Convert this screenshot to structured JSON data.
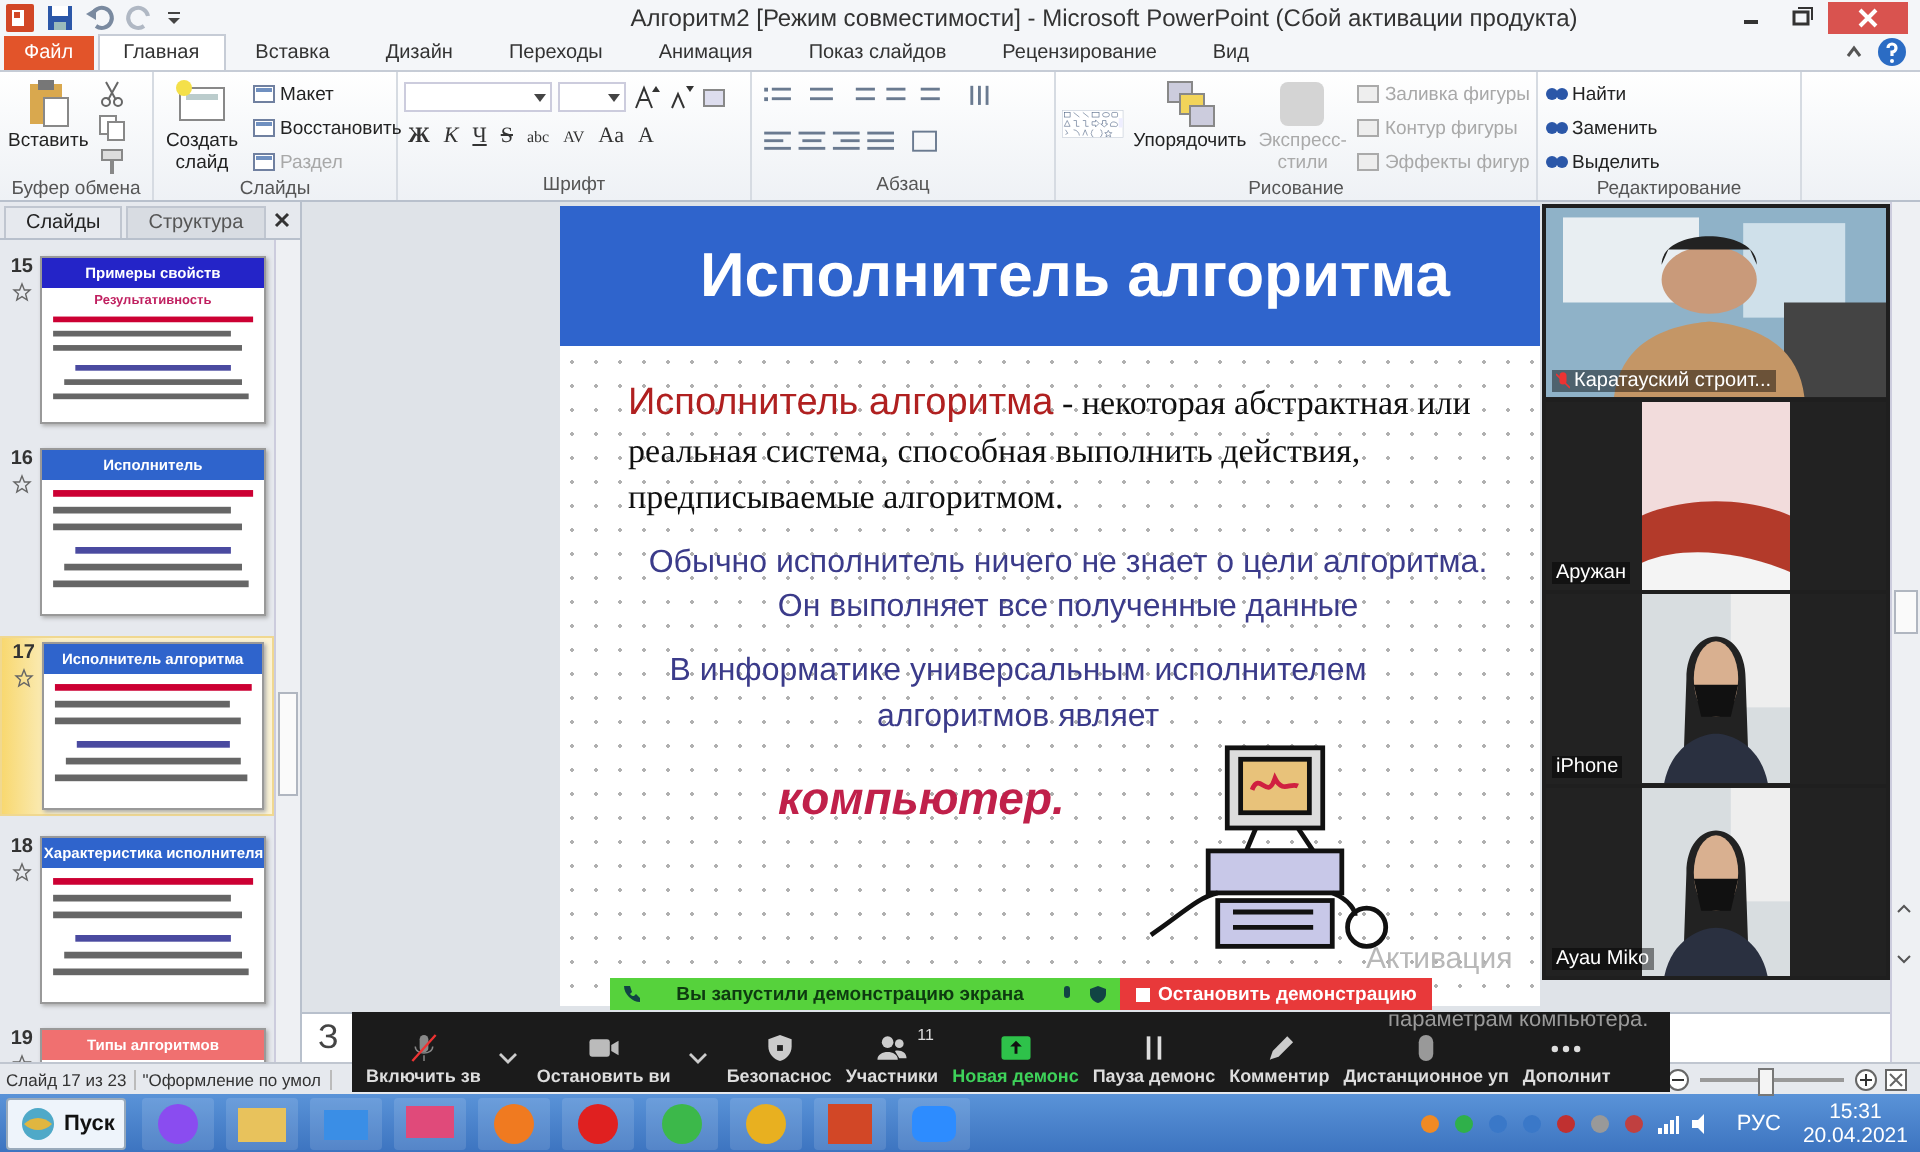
{
  "window": {
    "title": "Алгоритм2 [Режим совместимости] - Microsoft PowerPoint (Сбой активации продукта)"
  },
  "ribbon_tabs": [
    {
      "label": "Файл",
      "kind": "file",
      "selected": false
    },
    {
      "label": "Главная",
      "kind": "tab",
      "selected": true
    },
    {
      "label": "Вставка",
      "kind": "tab",
      "selected": false
    },
    {
      "label": "Дизайн",
      "kind": "tab",
      "selected": false
    },
    {
      "label": "Переходы",
      "kind": "tab",
      "selected": false
    },
    {
      "label": "Анимация",
      "kind": "tab",
      "selected": false
    },
    {
      "label": "Показ слайдов",
      "kind": "tab",
      "selected": false
    },
    {
      "label": "Рецензирование",
      "kind": "tab",
      "selected": false
    },
    {
      "label": "Вид",
      "kind": "tab",
      "selected": false
    }
  ],
  "clipboard": {
    "label": "Буфер обмена",
    "paste": "Вставить"
  },
  "slides_group": {
    "label": "Слайды",
    "new_slide": "Создать слайд",
    "items": [
      {
        "label": "Макет",
        "disabled": false
      },
      {
        "label": "Восстановить",
        "disabled": false
      },
      {
        "label": "Раздел",
        "disabled": true
      }
    ]
  },
  "font_group": {
    "label": "Шрифт",
    "buttons": [
      "Ж",
      "К",
      "Ч",
      "S",
      "abc",
      "AV",
      "Aa",
      "A"
    ]
  },
  "paragraph_group": {
    "label": "Абзац"
  },
  "drawing_group": {
    "label": "Рисование",
    "arrange": "Упорядочить",
    "quick_styles": {
      "label": "Экспресс-стили",
      "disabled": true
    },
    "items": [
      {
        "label": "Заливка фигуры",
        "disabled": true
      },
      {
        "label": "Контур фигуры",
        "disabled": true
      },
      {
        "label": "Эффекты фигур",
        "disabled": true
      }
    ]
  },
  "editing_group": {
    "label": "Редактирование",
    "items": [
      "Найти",
      "Заменить",
      "Выделить"
    ]
  },
  "pane_tabs": [
    {
      "label": "Слайды",
      "selected": true
    },
    {
      "label": "Структура",
      "selected": false
    }
  ],
  "thumbnails": [
    {
      "number": "15",
      "title": "Примеры свойств",
      "subtitle": "Результативность",
      "color": "#2424c8",
      "selected": false
    },
    {
      "number": "16",
      "title": "Исполнитель",
      "color": "#2f64cc",
      "selected": false
    },
    {
      "number": "17",
      "title": "Исполнитель алгоритма",
      "color": "#2f64cc",
      "selected": true
    },
    {
      "number": "18",
      "title": "Характеристика исполнителя",
      "color": "#2f64cc",
      "selected": false
    },
    {
      "number": "19",
      "title": "Типы алгоритмов",
      "color": "#f07070",
      "selected": false
    }
  ],
  "slide": {
    "title": "Исполнитель алгоритма",
    "term": "Исполнитель алгоритма",
    "definition": " - некоторая абстрактная или реальная система, способная выполнить действия, предписываемые алгоритмом.",
    "notes": [
      "Обычно исполнитель ничего не знает о цели алгоритма. Он выполняет все полученные данные",
      "В информатике универсальным исполнителем алгоритмов являет"
    ],
    "conclusion": "компьютер."
  },
  "notes_pane": {
    "text": "З"
  },
  "video_panel": {
    "participants": [
      {
        "name": "Каратауский строит...",
        "muted": true,
        "kind": "teacher"
      },
      {
        "name": "Аружан",
        "muted": false,
        "kind": "pillow"
      },
      {
        "name": "iPhone",
        "muted": false,
        "kind": "masked"
      },
      {
        "name": "Ayau Miko",
        "muted": false,
        "kind": "masked"
      }
    ]
  },
  "share_bar": {
    "message": "Вы запустили демонстрацию экрана",
    "stop": "Остановить демонстрацию"
  },
  "zoom_toolbar": [
    {
      "label": "Включить зв",
      "kind": "mic",
      "menu": true,
      "highlight": false
    },
    {
      "label": "Остановить ви",
      "kind": "video",
      "menu": true,
      "highlight": false
    },
    {
      "label": "Безопаснос",
      "kind": "shield",
      "menu": false,
      "highlight": false
    },
    {
      "label": "Участники",
      "kind": "people",
      "badge": "11",
      "menu": false,
      "highlight": false
    },
    {
      "label": "Новая демонс",
      "kind": "share",
      "menu": false,
      "highlight": true
    },
    {
      "label": "Пауза демонс",
      "kind": "pause",
      "menu": false,
      "highlight": false
    },
    {
      "label": "Комментир",
      "kind": "pencil",
      "menu": false,
      "highlight": false
    },
    {
      "label": "Дистанционное уп",
      "kind": "mouse",
      "menu": false,
      "highlight": false
    },
    {
      "label": "Дополнит",
      "kind": "more",
      "menu": false,
      "highlight": false
    }
  ],
  "activation": {
    "line1": "Активация",
    "line2": "параметрам компьютера."
  },
  "status_bar": {
    "slide_info": "Слайд 17 из 23",
    "theme": "\"Оформление по умол",
    "zoom": {
      "level": 0.45
    }
  },
  "taskbar": {
    "start": "Пуск",
    "language": "РУС",
    "time": "15:31",
    "date": "20.04.2021"
  }
}
